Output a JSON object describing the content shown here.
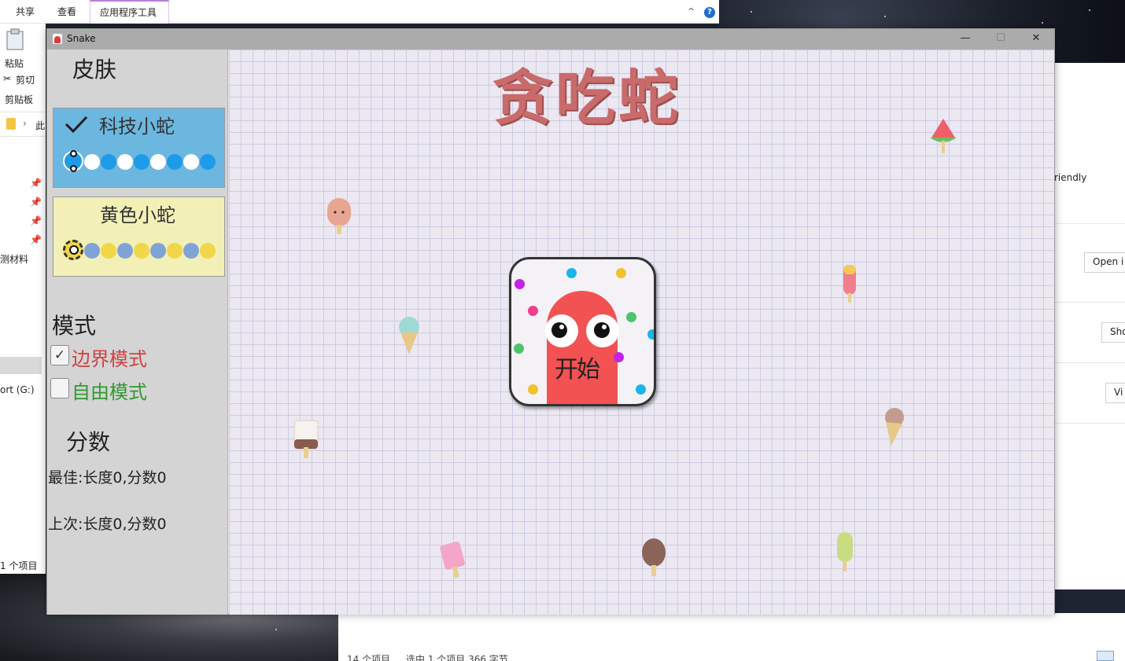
{
  "explorer": {
    "ribbon_tabs": [
      "共享",
      "查看",
      "应用程序工具"
    ],
    "paste_label": "粘贴",
    "cut_label": "剪切",
    "clipboard_label": "剪贴板",
    "path_fragment": "此",
    "folder_fragment": "测材料",
    "drive_fragment": "ort (G:)",
    "left_count": "1 个项目",
    "right_text": "riendly",
    "right_buttons": [
      "Open i",
      "Sho",
      "Vi"
    ],
    "status_count": "14 个项目",
    "status_selected": "选中 1 个项目  366 字节",
    "help_glyph": "?",
    "collapse_glyph": "^"
  },
  "window": {
    "title": "Snake",
    "minimize_glyph": "—",
    "maximize_glyph": "☐",
    "close_glyph": "✕"
  },
  "left_panel": {
    "skin_header": "皮肤",
    "skins": [
      {
        "name": "科技小蛇",
        "selected": true,
        "head_color": "#1e9be8",
        "body_colors": [
          "#ffffff",
          "#1e9be8"
        ]
      },
      {
        "name": "黄色小蛇",
        "selected": false,
        "head_color": "#f2d64a",
        "body_colors": [
          "#7fa3d6",
          "#f2d64a"
        ]
      }
    ],
    "mode_header": "模式",
    "modes": [
      {
        "label": "边界模式",
        "checked": true,
        "color": "#d14040"
      },
      {
        "label": "自由模式",
        "checked": false,
        "color": "#2f9a2f"
      }
    ],
    "score_header": "分数",
    "best": "最佳:长度0,分数0",
    "last": "上次:长度0,分数0"
  },
  "game": {
    "title": "贪吃蛇",
    "start_label": "开始",
    "dot_colors": [
      "#c522e6",
      "#18b5e8",
      "#f2c12b",
      "#ee3f8a",
      "#4cc46a"
    ]
  }
}
